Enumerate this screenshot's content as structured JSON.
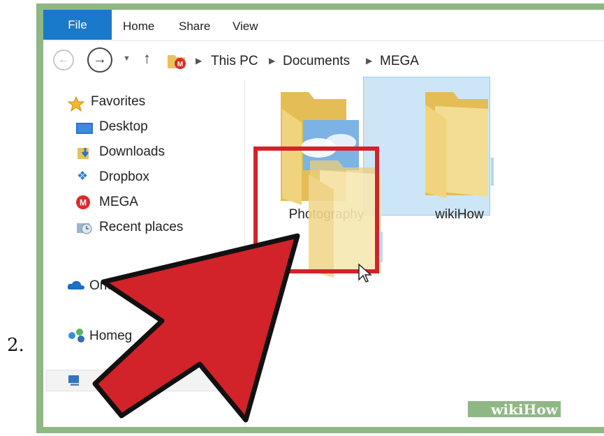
{
  "step_number": "2.",
  "ribbon": {
    "tabs": [
      "File",
      "Home",
      "Share",
      "View"
    ]
  },
  "breadcrumb": [
    "This PC",
    "Documents",
    "MEGA"
  ],
  "sidebar": {
    "items": [
      {
        "label": "Favorites",
        "icon": "star-icon"
      },
      {
        "label": "Desktop",
        "icon": "desktop-icon"
      },
      {
        "label": "Downloads",
        "icon": "downloads-icon"
      },
      {
        "label": "Dropbox",
        "icon": "dropbox-icon"
      },
      {
        "label": "MEGA",
        "icon": "mega-icon"
      },
      {
        "label": "Recent places",
        "icon": "recent-places-icon"
      },
      {
        "label": "OneD",
        "icon": "onedrive-icon"
      },
      {
        "label": "Homeg",
        "icon": "homegroup-icon"
      }
    ]
  },
  "folders": [
    {
      "name": "Photography",
      "selected": false
    },
    {
      "name": "wikiHow",
      "selected": true
    }
  ],
  "watermark": {
    "wiki": "wiki",
    "how": "How"
  },
  "colors": {
    "accent": "#1979ca",
    "arrow": "#d2232a",
    "frame": "#8fb784",
    "selection": "#cde6f7"
  }
}
